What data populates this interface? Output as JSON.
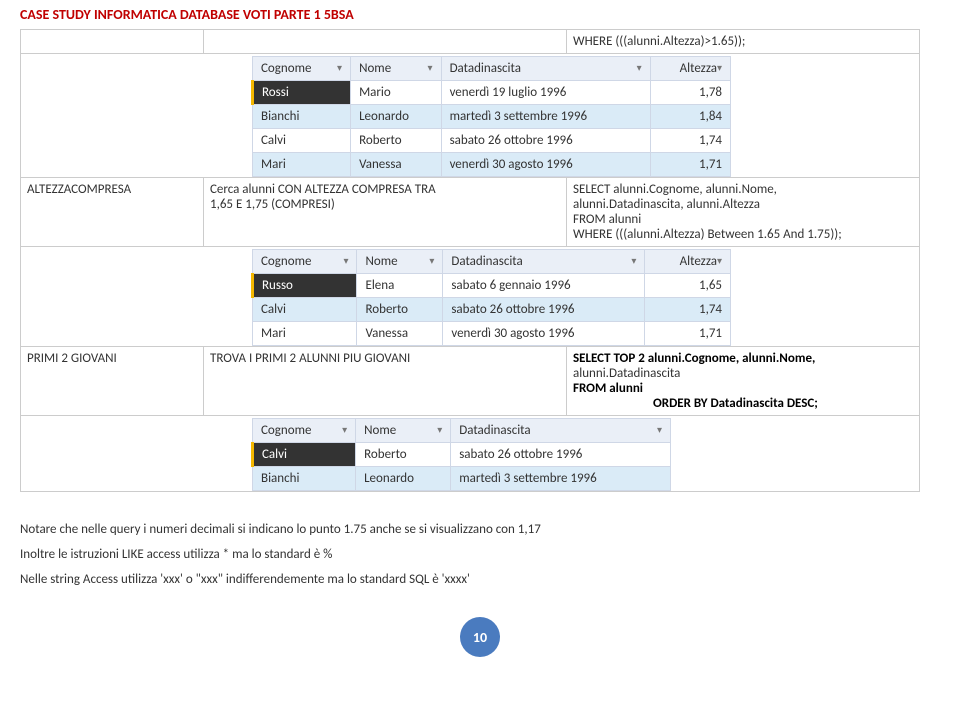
{
  "doc_title": "CASE STUDY INFORMATICA DATABASE VOTI PARTE 1 5BSA",
  "row_top": {
    "sql": "WHERE (((alunni.Altezza)>1.65));"
  },
  "grid1": {
    "headers": [
      "Cognome",
      "Nome",
      "Datadinascita",
      "Altezza"
    ],
    "rows": [
      [
        "Rossi",
        "Mario",
        "venerdì 19 luglio 1996",
        "1,78"
      ],
      [
        "Bianchi",
        "Leonardo",
        "martedì 3 settembre 1996",
        "1,84"
      ],
      [
        "Calvi",
        "Roberto",
        "sabato 26 ottobre 1996",
        "1,74"
      ],
      [
        "Mari",
        "Vanessa",
        "venerdì 30 agosto 1996",
        "1,71"
      ]
    ]
  },
  "row_comp": {
    "label": "ALTEZZACOMPRESA",
    "desc1": "Cerca alunni CON ALTEZZA COMPRESA TRA",
    "desc2": "1,65 E 1,75 (COMPRESI)",
    "sql1": " SELECT alunni.Cognome, alunni.Nome,",
    "sql2": "alunni.Datadinascita, alunni.Altezza",
    "sql3": "FROM alunni",
    "sql4": "WHERE (((alunni.Altezza) Between 1.65 And 1.75));"
  },
  "grid2": {
    "headers": [
      "Cognome",
      "Nome",
      "Datadinascita",
      "Altezza"
    ],
    "rows": [
      [
        "Russo",
        "Elena",
        "sabato 6 gennaio 1996",
        "1,65"
      ],
      [
        "Calvi",
        "Roberto",
        "sabato 26 ottobre 1996",
        "1,74"
      ],
      [
        "Mari",
        "Vanessa",
        "venerdì 30 agosto 1996",
        "1,71"
      ]
    ]
  },
  "row_giov": {
    "label": "PRIMI 2 GIOVANI",
    "desc": "TROVA I PRIMI 2 ALUNNI PIU GIOVANI",
    "sql1": "SELECT TOP 2 alunni.Cognome, alunni.Nome,",
    "sql2": "alunni.Datadinascita",
    "sql3": "FROM alunni",
    "sql4": "ORDER BY Datadinascita DESC;"
  },
  "grid3": {
    "headers": [
      "Cognome",
      "Nome",
      "Datadinascita"
    ],
    "rows": [
      [
        "Calvi",
        "Roberto",
        "sabato 26 ottobre 1996"
      ],
      [
        "Bianchi",
        "Leonardo",
        "martedì 3 settembre 1996"
      ]
    ]
  },
  "notes": {
    "n1": "Notare che nelle query i numeri decimali si indicano lo punto 1.75 anche se si visualizzano con 1,17",
    "n2": "Inoltre le istruzioni LIKE access utilizza * ma lo standard è %",
    "n3": "Nelle string Access utilizza 'xxx' o \"xxx\" indifferendemente ma lo standard SQL è 'xxxx'"
  },
  "page_number": "10"
}
